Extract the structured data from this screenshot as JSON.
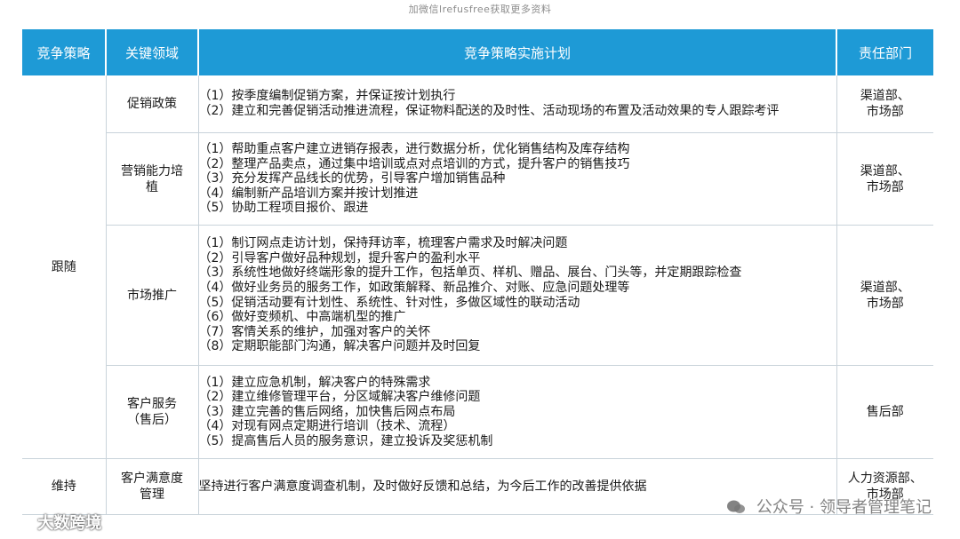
{
  "watermark_top": "加微信lrefusfree获取更多资料",
  "headers": {
    "strategy": "竞争策略",
    "area": "关键领域",
    "plan": "竞争策略实施计划",
    "dept": "责任部门"
  },
  "groups": [
    {
      "strategy": "跟随",
      "rows": [
        {
          "area": [
            "促销政策"
          ],
          "items": [
            "（1）按季度编制促销方案，并保证按计划执行",
            "（2）建立和完善促销活动推进流程，保证物料配送的及时性、活动现场的布置及活动效果的专人跟踪考评"
          ],
          "dept": [
            "渠道部、",
            "市场部"
          ]
        },
        {
          "area": [
            "营销能力培",
            "植"
          ],
          "items": [
            "（1）帮助重点客户建立进销存报表，进行数据分析，优化销售结构及库存结构",
            "（2）整理产品卖点，通过集中培训或点对点培训的方式，提升客户的销售技巧",
            "（3）充分发挥产品线长的优势，引导客户增加销售品种",
            "（4）编制新产品培训方案并按计划推进",
            "（5）协助工程项目报价、跟进"
          ],
          "dept": [
            "渠道部、",
            "市场部"
          ]
        },
        {
          "area": [
            "市场推广"
          ],
          "items": [
            "（1）制订网点走访计划，保持拜访率，梳理客户需求及时解决问题",
            "（2）引导客户做好品种规划，提升客户的盈利水平",
            "（3）系统性地做好终端形象的提升工作，包括单页、样机、赠品、展台、门头等，并定期跟踪检查",
            "（4）做好业务员的服务工作，如政策解释、新品推介、对账、应急问题处理等",
            "（5）促销活动要有计划性、系统性、针对性，多做区域性的联动活动",
            "（6）做好变频机、中高端机型的推广",
            "（7）客情关系的维护，加强对客户的关怀",
            "（8）定期职能部门沟通，解决客户问题并及时回复"
          ],
          "dept": [
            "渠道部、",
            "市场部"
          ]
        },
        {
          "area": [
            "客户服务",
            "（售后）"
          ],
          "items": [
            "（1）建立应急机制，解决客户的特殊需求",
            "（2）建立维修管理平台，分区域解决客户维修问题",
            "（3）建立完善的售后网络，加快售后网点布局",
            "（4）对现有网点定期进行培训（技术、流程）",
            "（5）提高售后人员的服务意识，建立投诉及奖惩机制"
          ],
          "dept": [
            "售后部"
          ]
        }
      ]
    },
    {
      "strategy": "维持",
      "rows": [
        {
          "area": [
            "客户满意度",
            "管理"
          ],
          "items": [
            "坚持进行客户满意度调查机制，及时做好反馈和总结，为今后工作的改善提供依据"
          ],
          "dept": [
            "人力资源部、",
            "市场部"
          ]
        }
      ]
    }
  ],
  "watermark_bottom_left": "大数跨境",
  "watermark_bottom_right": "公众号 · 领导者管理笔记",
  "colors": {
    "header_bg": "#1e9ad6",
    "header_text": "#ffffff",
    "border": "#c9d3da"
  }
}
